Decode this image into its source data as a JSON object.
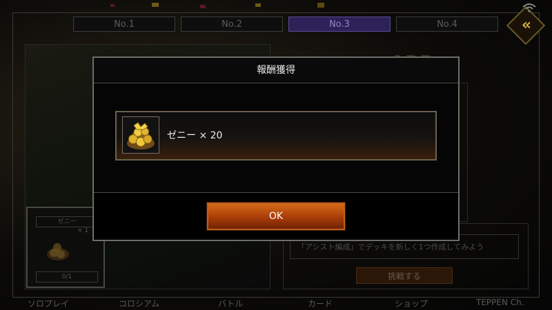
{
  "tabs": [
    "No.1",
    "No.2",
    "No.3",
    "No.4"
  ],
  "active_tab_index": 2,
  "board_title": "ARD",
  "mini_card": {
    "title": "ゼニー",
    "count": "× 1",
    "progress": "0/1"
  },
  "mission": {
    "description": "「アシスト編成」でデッキを新しく1つ作成してみよう",
    "challenge_label": "挑戦する"
  },
  "bottom_nav": [
    "ソロプレイ",
    "コロシアム",
    "バトル",
    "カード",
    "ショップ",
    "TEPPEN Ch."
  ],
  "modal": {
    "title": "報酬獲得",
    "reward_label": "ゼニー × 20",
    "reward_icon": "coin-bag-icon",
    "ok_label": "OK"
  },
  "colors": {
    "ok_button": "#c0521a",
    "active_tab": "#2c2258",
    "modal_border": "#6e6e6a"
  }
}
